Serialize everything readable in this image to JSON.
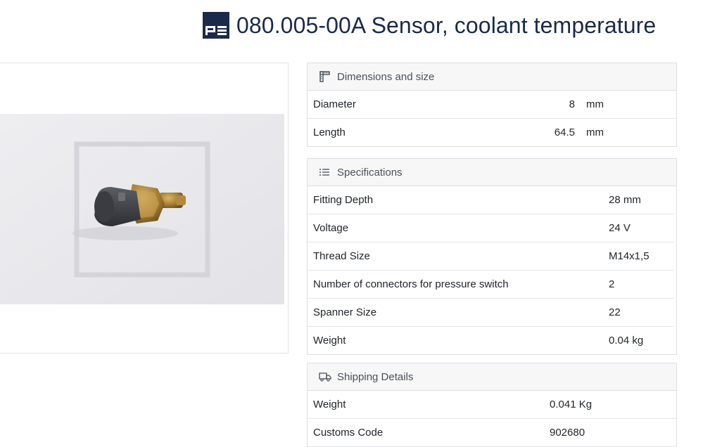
{
  "header": {
    "title": "080.005-00A Sensor, coolant temperature",
    "logo_icon": "pe-logo-icon",
    "logo_text": "PE"
  },
  "dimensions": {
    "title": "Dimensions and size",
    "icon": "ruler-icon",
    "rows": [
      {
        "label": "Diameter",
        "value": "8",
        "unit": "mm"
      },
      {
        "label": "Length",
        "value": "64.5",
        "unit": "mm"
      }
    ]
  },
  "specifications": {
    "title": "Specifications",
    "icon": "list-icon",
    "rows": [
      {
        "label": "Fitting Depth",
        "value": "28 mm"
      },
      {
        "label": "Voltage",
        "value": "24 V"
      },
      {
        "label": "Thread Size",
        "value": "M14x1,5"
      },
      {
        "label": "Number of connectors for pressure switch",
        "value": "2"
      },
      {
        "label": "Spanner Size",
        "value": "22"
      },
      {
        "label": "Weight",
        "value": "0.04 kg"
      }
    ]
  },
  "shipping": {
    "title": "Shipping Details",
    "icon": "truck-icon",
    "rows": [
      {
        "label": "Weight",
        "value": "0.041 Kg"
      },
      {
        "label": "Customs Code",
        "value": "902680"
      }
    ]
  },
  "colors": {
    "brand": "#1b2a4a",
    "card_header_bg": "#f7f7f8",
    "border": "#dcdfe3"
  }
}
